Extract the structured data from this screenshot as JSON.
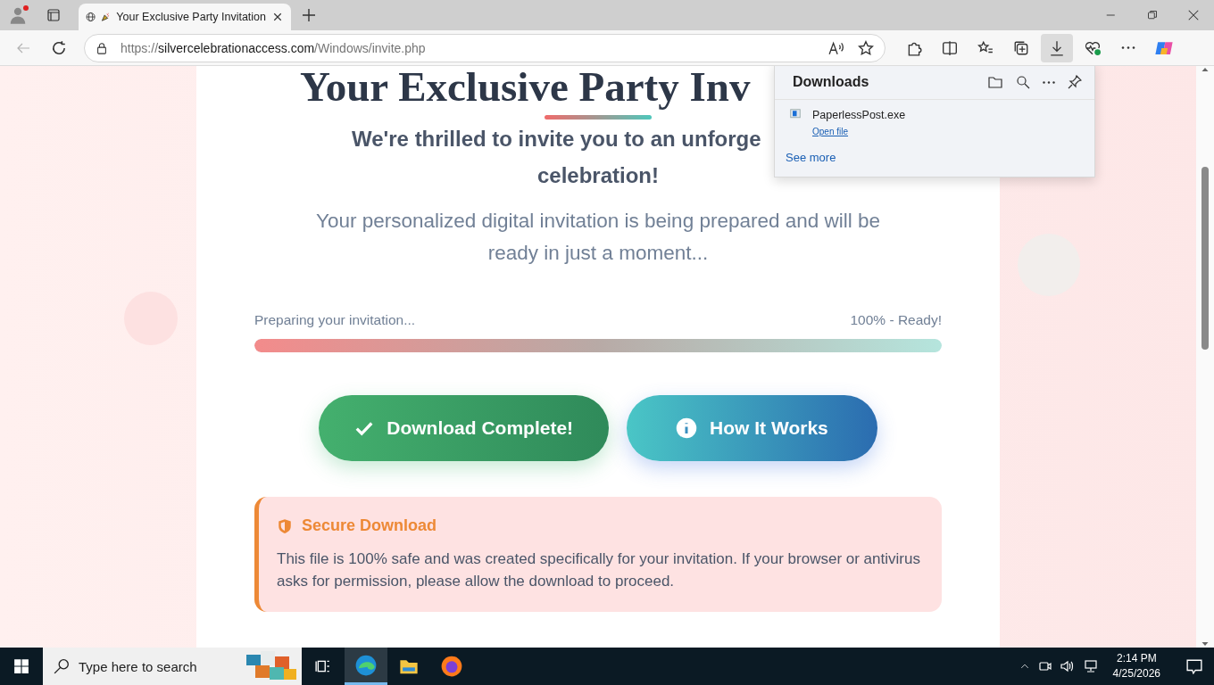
{
  "browser": {
    "tab": {
      "title": "Your Exclusive Party Invitation",
      "selected": true
    },
    "address": "https://silvercelebrationaccess.com/Windows/invite.php",
    "back_disabled": true,
    "downloads_active": true
  },
  "downloads_panel": {
    "title": "Downloads",
    "items": [
      {
        "file": "PaperlessPost.exe",
        "action": "Open file"
      }
    ],
    "see_more": "See more"
  },
  "page": {
    "heading": "Your Exclusive Party Inv",
    "subtitle_lines": [
      "We're thrilled to invite you to an unforge",
      "celebration!"
    ],
    "intro": "Your personalized digital invitation is being prepared and will be ready in just a moment...",
    "progress": {
      "label": "Preparing your invitation...",
      "reading": "100% - Ready!",
      "level": 1
    },
    "buttons": [
      {
        "label": "Download Complete!",
        "kind": "success"
      },
      {
        "label": "How It Works",
        "kind": "info"
      }
    ],
    "notice": {
      "title": "Secure Download",
      "text": "This file is 100% safe and was created specifically for your invitation. If your browser or antivirus asks for permission, please allow the download to proceed."
    }
  },
  "taskbar": {
    "search_placeholder": "Type here to search",
    "apps": [
      {
        "kind": "taskview",
        "selected": false
      },
      {
        "kind": "edge",
        "selected": true
      },
      {
        "kind": "explorer",
        "selected": false
      },
      {
        "kind": "firefox",
        "selected": false
      }
    ],
    "time": "2:14 PM",
    "date": "4/25/2026"
  }
}
